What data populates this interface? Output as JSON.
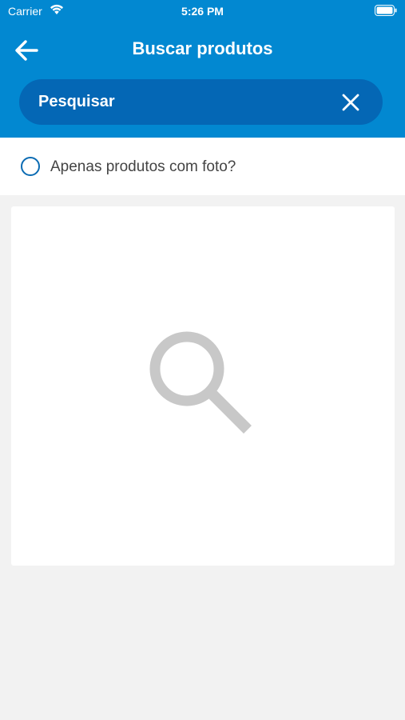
{
  "status_bar": {
    "carrier": "Carrier",
    "time": "5:26 PM"
  },
  "header": {
    "title": "Buscar produtos",
    "background_color": "#0288d1",
    "back_icon": "arrow-left-icon"
  },
  "search": {
    "placeholder": "Pesquisar",
    "value": "",
    "clear_icon": "close-icon",
    "background_color": "#0467b5"
  },
  "filter": {
    "label": "Apenas produtos com foto?",
    "checked": false
  },
  "results": {
    "empty_state_icon": "search-icon",
    "icon_color": "#c8c8c8"
  }
}
